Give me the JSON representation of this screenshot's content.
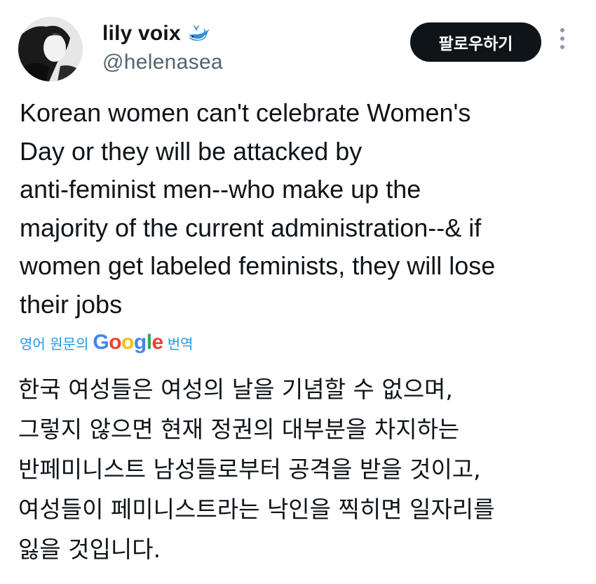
{
  "author": {
    "display_name": "lily voix",
    "display_name_icon": "whale-icon",
    "handle": "@helenasea"
  },
  "actions": {
    "follow_label": "팔로우하기",
    "more_icon": "more-vertical-icon"
  },
  "tweet": {
    "text": "Korean women can't celebrate Women's\nDay or they will be attacked by\nanti-feminist men--who make up the\nmajority of the current administration--& if\nwomen get labeled feminists, they will lose\ntheir jobs"
  },
  "translation": {
    "prefix": "영어 원문의",
    "provider": "Google",
    "suffix": "번역",
    "text": "한국 여성들은 여성의 날을 기념할 수 없으며,\n그렇지 않으면 현재 정권의 대부분을 차지하는\n반페미니스트 남성들로부터 공격을 받을 것이고,\n여성들이 페미니스트라는 낙인을 찍히면 일자리를\n잃을 것입니다."
  },
  "colors": {
    "text": "#0f1419",
    "secondary": "#536471",
    "accent": "#1d9bf0",
    "button_bg": "#0f1419"
  }
}
